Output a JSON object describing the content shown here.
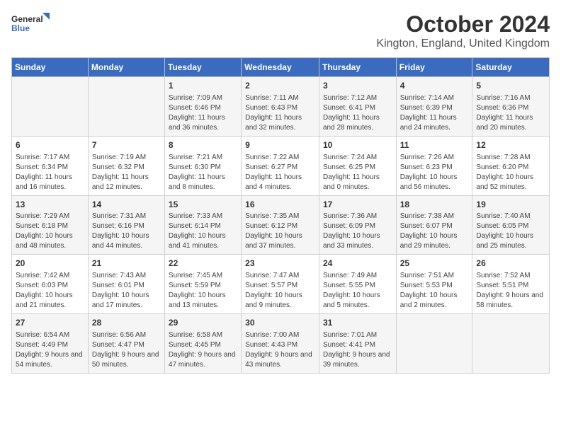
{
  "logo": {
    "line1": "General",
    "line2": "Blue"
  },
  "title": "October 2024",
  "location": "Kington, England, United Kingdom",
  "days_of_week": [
    "Sunday",
    "Monday",
    "Tuesday",
    "Wednesday",
    "Thursday",
    "Friday",
    "Saturday"
  ],
  "weeks": [
    [
      {
        "day": "",
        "info": ""
      },
      {
        "day": "",
        "info": ""
      },
      {
        "day": "1",
        "info": "Sunrise: 7:09 AM\nSunset: 6:46 PM\nDaylight: 11 hours and 36 minutes."
      },
      {
        "day": "2",
        "info": "Sunrise: 7:11 AM\nSunset: 6:43 PM\nDaylight: 11 hours and 32 minutes."
      },
      {
        "day": "3",
        "info": "Sunrise: 7:12 AM\nSunset: 6:41 PM\nDaylight: 11 hours and 28 minutes."
      },
      {
        "day": "4",
        "info": "Sunrise: 7:14 AM\nSunset: 6:39 PM\nDaylight: 11 hours and 24 minutes."
      },
      {
        "day": "5",
        "info": "Sunrise: 7:16 AM\nSunset: 6:36 PM\nDaylight: 11 hours and 20 minutes."
      }
    ],
    [
      {
        "day": "6",
        "info": "Sunrise: 7:17 AM\nSunset: 6:34 PM\nDaylight: 11 hours and 16 minutes."
      },
      {
        "day": "7",
        "info": "Sunrise: 7:19 AM\nSunset: 6:32 PM\nDaylight: 11 hours and 12 minutes."
      },
      {
        "day": "8",
        "info": "Sunrise: 7:21 AM\nSunset: 6:30 PM\nDaylight: 11 hours and 8 minutes."
      },
      {
        "day": "9",
        "info": "Sunrise: 7:22 AM\nSunset: 6:27 PM\nDaylight: 11 hours and 4 minutes."
      },
      {
        "day": "10",
        "info": "Sunrise: 7:24 AM\nSunset: 6:25 PM\nDaylight: 11 hours and 0 minutes."
      },
      {
        "day": "11",
        "info": "Sunrise: 7:26 AM\nSunset: 6:23 PM\nDaylight: 10 hours and 56 minutes."
      },
      {
        "day": "12",
        "info": "Sunrise: 7:28 AM\nSunset: 6:20 PM\nDaylight: 10 hours and 52 minutes."
      }
    ],
    [
      {
        "day": "13",
        "info": "Sunrise: 7:29 AM\nSunset: 6:18 PM\nDaylight: 10 hours and 48 minutes."
      },
      {
        "day": "14",
        "info": "Sunrise: 7:31 AM\nSunset: 6:16 PM\nDaylight: 10 hours and 44 minutes."
      },
      {
        "day": "15",
        "info": "Sunrise: 7:33 AM\nSunset: 6:14 PM\nDaylight: 10 hours and 41 minutes."
      },
      {
        "day": "16",
        "info": "Sunrise: 7:35 AM\nSunset: 6:12 PM\nDaylight: 10 hours and 37 minutes."
      },
      {
        "day": "17",
        "info": "Sunrise: 7:36 AM\nSunset: 6:09 PM\nDaylight: 10 hours and 33 minutes."
      },
      {
        "day": "18",
        "info": "Sunrise: 7:38 AM\nSunset: 6:07 PM\nDaylight: 10 hours and 29 minutes."
      },
      {
        "day": "19",
        "info": "Sunrise: 7:40 AM\nSunset: 6:05 PM\nDaylight: 10 hours and 25 minutes."
      }
    ],
    [
      {
        "day": "20",
        "info": "Sunrise: 7:42 AM\nSunset: 6:03 PM\nDaylight: 10 hours and 21 minutes."
      },
      {
        "day": "21",
        "info": "Sunrise: 7:43 AM\nSunset: 6:01 PM\nDaylight: 10 hours and 17 minutes."
      },
      {
        "day": "22",
        "info": "Sunrise: 7:45 AM\nSunset: 5:59 PM\nDaylight: 10 hours and 13 minutes."
      },
      {
        "day": "23",
        "info": "Sunrise: 7:47 AM\nSunset: 5:57 PM\nDaylight: 10 hours and 9 minutes."
      },
      {
        "day": "24",
        "info": "Sunrise: 7:49 AM\nSunset: 5:55 PM\nDaylight: 10 hours and 5 minutes."
      },
      {
        "day": "25",
        "info": "Sunrise: 7:51 AM\nSunset: 5:53 PM\nDaylight: 10 hours and 2 minutes."
      },
      {
        "day": "26",
        "info": "Sunrise: 7:52 AM\nSunset: 5:51 PM\nDaylight: 9 hours and 58 minutes."
      }
    ],
    [
      {
        "day": "27",
        "info": "Sunrise: 6:54 AM\nSunset: 4:49 PM\nDaylight: 9 hours and 54 minutes."
      },
      {
        "day": "28",
        "info": "Sunrise: 6:56 AM\nSunset: 4:47 PM\nDaylight: 9 hours and 50 minutes."
      },
      {
        "day": "29",
        "info": "Sunrise: 6:58 AM\nSunset: 4:45 PM\nDaylight: 9 hours and 47 minutes."
      },
      {
        "day": "30",
        "info": "Sunrise: 7:00 AM\nSunset: 4:43 PM\nDaylight: 9 hours and 43 minutes."
      },
      {
        "day": "31",
        "info": "Sunrise: 7:01 AM\nSunset: 4:41 PM\nDaylight: 9 hours and 39 minutes."
      },
      {
        "day": "",
        "info": ""
      },
      {
        "day": "",
        "info": ""
      }
    ]
  ]
}
